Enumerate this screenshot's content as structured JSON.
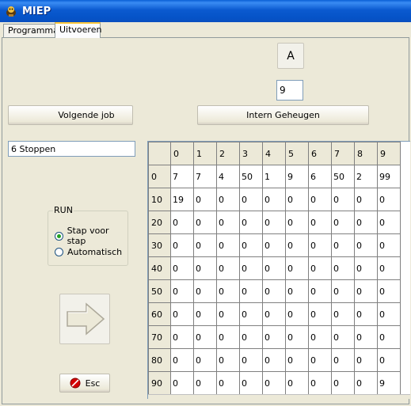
{
  "window": {
    "title": "MIEP",
    "icon": "app-icon"
  },
  "tabs": [
    {
      "label": "Programma",
      "active": false
    },
    {
      "label": "Uitvoeren",
      "active": true
    }
  ],
  "accumulator": {
    "label": "A",
    "value": "9"
  },
  "buttons": {
    "next_job": "Volgende job",
    "internal_memory": "Intern Geheugen",
    "esc": "Esc"
  },
  "status_field": "6  Stoppen",
  "run_group": {
    "legend": "RUN",
    "options": [
      {
        "label": "Stap voor stap",
        "checked": true
      },
      {
        "label": "Automatisch",
        "checked": false
      }
    ]
  },
  "memory_grid": {
    "column_headers": [
      "0",
      "1",
      "2",
      "3",
      "4",
      "5",
      "6",
      "7",
      "8",
      "9"
    ],
    "row_headers": [
      "0",
      "10",
      "20",
      "30",
      "40",
      "50",
      "60",
      "70",
      "80",
      "90"
    ],
    "rows": [
      [
        "7",
        "7",
        "4",
        "50",
        "1",
        "9",
        "6",
        "50",
        "2",
        "99"
      ],
      [
        "19",
        "0",
        "0",
        "0",
        "0",
        "0",
        "0",
        "0",
        "0",
        "0"
      ],
      [
        "0",
        "0",
        "0",
        "0",
        "0",
        "0",
        "0",
        "0",
        "0",
        "0"
      ],
      [
        "0",
        "0",
        "0",
        "0",
        "0",
        "0",
        "0",
        "0",
        "0",
        "0"
      ],
      [
        "0",
        "0",
        "0",
        "0",
        "0",
        "0",
        "0",
        "0",
        "0",
        "0"
      ],
      [
        "0",
        "0",
        "0",
        "0",
        "0",
        "0",
        "0",
        "0",
        "0",
        "0"
      ],
      [
        "0",
        "0",
        "0",
        "0",
        "0",
        "0",
        "0",
        "0",
        "0",
        "0"
      ],
      [
        "0",
        "0",
        "0",
        "0",
        "0",
        "0",
        "0",
        "0",
        "0",
        "0"
      ],
      [
        "0",
        "0",
        "0",
        "0",
        "0",
        "0",
        "0",
        "0",
        "0",
        "0"
      ],
      [
        "0",
        "0",
        "0",
        "0",
        "0",
        "0",
        "0",
        "0",
        "0",
        "9"
      ]
    ]
  },
  "colors": {
    "titlebar": "#0553c7",
    "radio_dot": "#21a121",
    "esc_icon": "#d40000"
  }
}
